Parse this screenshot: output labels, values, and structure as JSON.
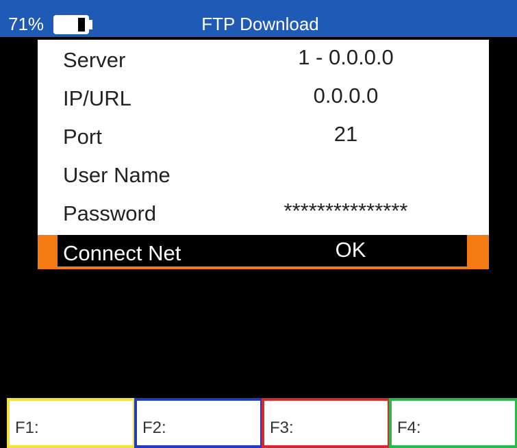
{
  "status": {
    "battery_percent": "71%",
    "battery_level": 0.71
  },
  "header": {
    "title": "FTP Download"
  },
  "form": {
    "rows": [
      {
        "label": "Server",
        "value": "1 - 0.0.0.0"
      },
      {
        "label": "IP/URL",
        "value": "0.0.0.0"
      },
      {
        "label": "Port",
        "value": "21"
      },
      {
        "label": "User Name",
        "value": ""
      },
      {
        "label": "Password",
        "value": "***************"
      }
    ],
    "selected": {
      "label": "Connect Net",
      "value": "OK"
    }
  },
  "function_keys": [
    {
      "label": "F1:",
      "color": "#f2e23a"
    },
    {
      "label": "F2:",
      "color": "#1f3bbf"
    },
    {
      "label": "F3:",
      "color": "#d8282e"
    },
    {
      "label": "F4:",
      "color": "#2fb64a"
    }
  ],
  "colors": {
    "header_bg": "#1f5bb6",
    "panel_bg": "#ffffff",
    "selection_accent": "#f47a12",
    "screen_bg": "#000000"
  }
}
